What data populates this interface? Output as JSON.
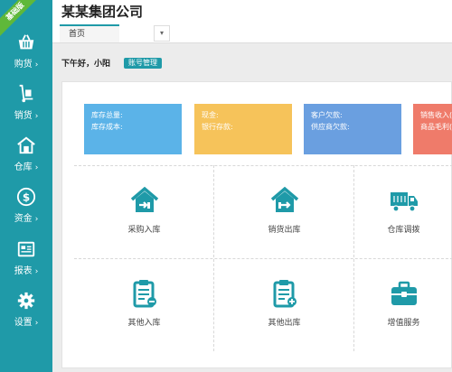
{
  "sidebar": {
    "badge": "基础版",
    "items": [
      {
        "label": "购货",
        "arrow": "›"
      },
      {
        "label": "销货",
        "arrow": "›"
      },
      {
        "label": "仓库",
        "arrow": "›"
      },
      {
        "label": "资金",
        "arrow": "›"
      },
      {
        "label": "报表",
        "arrow": "›"
      },
      {
        "label": "设置",
        "arrow": "›"
      }
    ]
  },
  "header": {
    "company": "某某集团公司",
    "tab": "首页",
    "tab_more": "▾"
  },
  "greeting": {
    "text": "下午好，小阳",
    "account_button": "账号管理"
  },
  "cards": [
    {
      "line1": "库存总量:",
      "line2": "库存成本:",
      "color": "#5bb3e8"
    },
    {
      "line1": "现金:",
      "line2": "银行存款:",
      "color": "#f6c35a"
    },
    {
      "line1": "客户欠款:",
      "line2": "供应商欠款:",
      "color": "#6a9fe0"
    },
    {
      "line1": "销售收入(",
      "line2": "商品毛利(",
      "color": "#ef7b6a"
    }
  ],
  "actions": [
    {
      "label": "采购入库"
    },
    {
      "label": "销货出库"
    },
    {
      "label": "仓库调拨"
    },
    {
      "label": "其他入库"
    },
    {
      "label": "其他出库"
    },
    {
      "label": "增值服务"
    }
  ],
  "colors": {
    "accent": "#1f9aa8",
    "badge": "#5fb83a"
  }
}
